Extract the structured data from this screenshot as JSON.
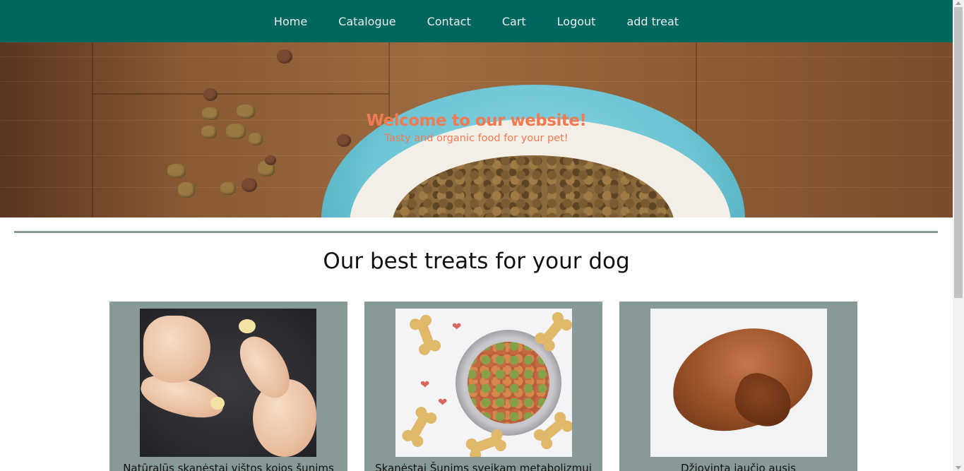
{
  "nav": {
    "items": [
      {
        "label": "Home"
      },
      {
        "label": "Catalogue"
      },
      {
        "label": "Contact"
      },
      {
        "label": "Cart"
      },
      {
        "label": "Logout"
      },
      {
        "label": "add treat"
      }
    ]
  },
  "hero": {
    "title": "Welcome to our website!",
    "subtitle": "Tasty and organic food for your pet!"
  },
  "main": {
    "section_title": "Our best treats for your dog",
    "products": [
      {
        "caption": "Natūralūs skanėstai vištos kojos šunims",
        "image": "chicken-legs"
      },
      {
        "caption": "Skanėstai Šunims sveikam metabolizmui",
        "image": "kibble-bowl"
      },
      {
        "caption": "Džiovinta jaučio ausis",
        "image": "dried-ear"
      }
    ]
  },
  "colors": {
    "nav_bg": "#00675f",
    "hero_text": "#f07a52",
    "card_bg": "#879a97",
    "divider": "#869996"
  }
}
